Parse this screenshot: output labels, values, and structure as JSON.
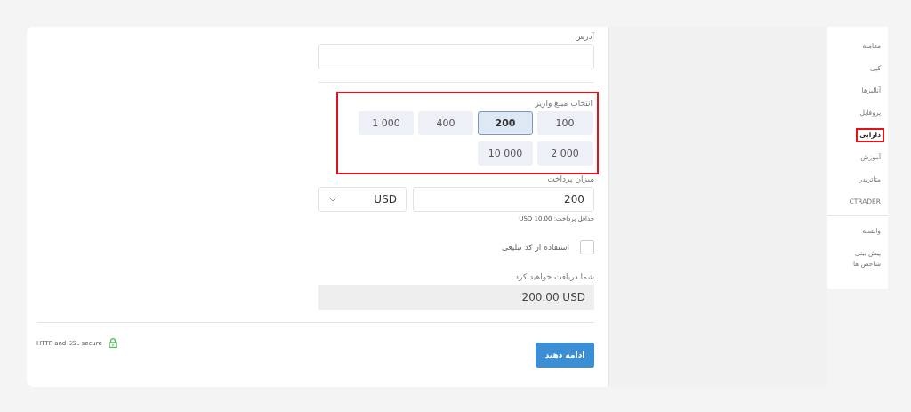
{
  "address": {
    "label": "آدرس"
  },
  "deposit_amount": {
    "label": "انتخاب مبلغ واریز",
    "highlighted": true,
    "options": [
      {
        "label": "100",
        "selected": false
      },
      {
        "label": "200",
        "selected": true
      },
      {
        "label": "400",
        "selected": false
      },
      {
        "label": "1 000",
        "selected": false
      },
      {
        "label": "2 000",
        "selected": false
      },
      {
        "label": "10 000",
        "selected": false
      }
    ]
  },
  "payment": {
    "label": "میزان پرداخت",
    "amount": "200",
    "currency": "USD",
    "hint": "حداقل پرداخت: USD 10.00"
  },
  "promo": {
    "label": "استفاده از کد تبلیغی",
    "checked": false
  },
  "receive": {
    "label": "شما دریافت خواهید کرد",
    "value": "200.00 USD"
  },
  "footer": {
    "secure": "HTTP and SSL secure",
    "button": "ادامه دهید"
  },
  "sidebar": {
    "items": [
      {
        "label": "معامله",
        "selected": false,
        "highlighted": false
      },
      {
        "label": "کپی",
        "selected": false,
        "highlighted": false
      },
      {
        "label": "آنالیزها",
        "selected": false,
        "highlighted": false
      },
      {
        "label": "پروفایل",
        "selected": false,
        "highlighted": false
      },
      {
        "label": "دارایی",
        "selected": true,
        "highlighted": true
      },
      {
        "label": "آموزش",
        "selected": false,
        "highlighted": false
      },
      {
        "label": "متاتریدر",
        "selected": false,
        "highlighted": false
      },
      {
        "label": "CTRADER",
        "selected": false,
        "highlighted": false
      }
    ],
    "secondary": [
      {
        "label": "وابسته",
        "selected": false,
        "highlighted": false
      },
      {
        "label": "پیش بینی شاخص ها",
        "selected": false,
        "highlighted": false
      }
    ]
  }
}
